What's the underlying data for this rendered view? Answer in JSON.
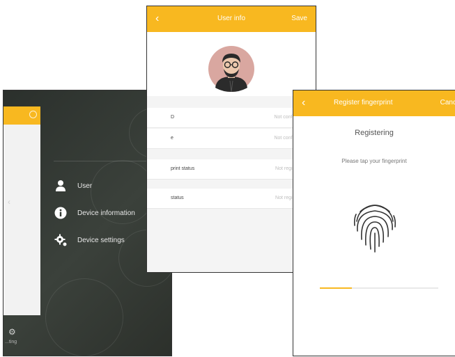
{
  "menu_screen": {
    "items": [
      {
        "label": "User",
        "icon": "user-icon"
      },
      {
        "label": "Device information",
        "icon": "info-icon"
      },
      {
        "label": "Device settings",
        "icon": "gear-icon"
      }
    ],
    "bottom_label": "...ting"
  },
  "user_screen": {
    "back_icon": "chevron-left-icon",
    "title": "User info",
    "save_label": "Save",
    "rows": [
      {
        "label": "D",
        "value": "Not configured"
      },
      {
        "label": "e",
        "value": "Not configured"
      },
      {
        "label": "print status",
        "value": "Not registered"
      },
      {
        "label": "status",
        "value": "Not registered"
      }
    ]
  },
  "fingerprint_screen": {
    "back_icon": "chevron-left-icon",
    "title": "Register fingerprint",
    "cancel_label": "Canc",
    "heading": "Registering",
    "hint": "Please tap your fingerprint",
    "progress": 0.27
  },
  "colors": {
    "accent": "#f8b820",
    "dark_bg": "#343a34"
  }
}
